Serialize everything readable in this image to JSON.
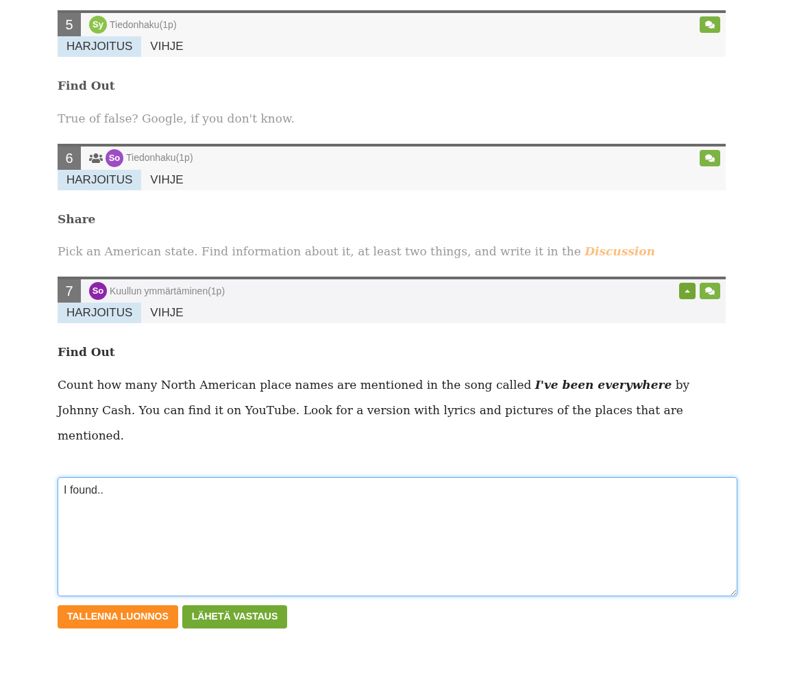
{
  "tasks": [
    {
      "number": "5",
      "group": false,
      "avatar": {
        "initials": "Sy",
        "color": "#8bc34a"
      },
      "category": "Tiedonhaku(1p)",
      "expanded": false,
      "tabs": [
        {
          "label": "HARJOITUS",
          "selected": true
        },
        {
          "label": "VIHJE",
          "selected": false
        }
      ],
      "title": "Find Out",
      "body": "True of false? Google, if you don't know."
    },
    {
      "number": "6",
      "group": true,
      "avatar": {
        "initials": "So",
        "color": "#9c4dc4"
      },
      "category": "Tiedonhaku(1p)",
      "expanded": false,
      "tabs": [
        {
          "label": "HARJOITUS",
          "selected": true
        },
        {
          "label": "VIHJE",
          "selected": false
        }
      ],
      "title": "Share",
      "body": "Pick an American state. Find information about it, at least two things, and write it in the",
      "link": "Discussion"
    },
    {
      "number": "7",
      "group": false,
      "avatar": {
        "initials": "So",
        "color": "#8e24aa"
      },
      "category": "Kuullun ymmärtäminen(1p)",
      "expanded": true,
      "tabs": [
        {
          "label": "HARJOITUS",
          "selected": true
        },
        {
          "label": "VIHJE",
          "selected": false
        }
      ],
      "title": "Find Out",
      "body": "Count how many North American place names are mentioned in the song called **I've been everywhere** by Johnny Cash. You can find it on YouTube. Look for a version with lyrics and pictures of the places that are mentioned."
    }
  ],
  "answer": {
    "value": "I found.."
  },
  "buttons": [
    {
      "label": "TALLENNA LUONNOS",
      "kind": "draft"
    },
    {
      "label": "LÄHETÄ VASTAUS",
      "kind": "submit"
    }
  ]
}
